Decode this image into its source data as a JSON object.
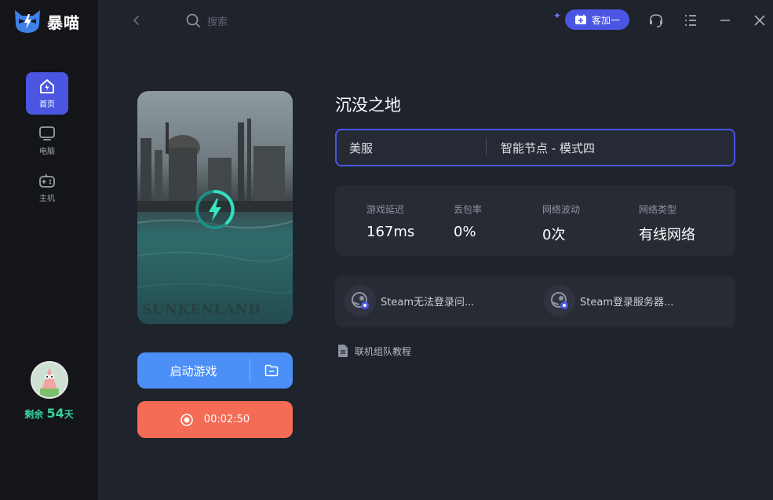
{
  "app": {
    "name": "暴喵"
  },
  "nav": {
    "items": [
      {
        "label": "首页",
        "icon": "home-icon",
        "active": true
      },
      {
        "label": "电脑",
        "icon": "monitor-icon",
        "active": false
      },
      {
        "label": "主机",
        "icon": "gamepad-icon",
        "active": false
      }
    ]
  },
  "user": {
    "remain_prefix": "剩余",
    "remain_days": "54",
    "remain_suffix": "天"
  },
  "topbar": {
    "search_placeholder": "搜索",
    "add_button_label": "客加一",
    "icons": [
      "back-icon",
      "search-icon",
      "headset-icon",
      "menu-icon",
      "minimize-icon",
      "close-icon"
    ]
  },
  "game": {
    "name": "沉没之地",
    "art_title": "SUNKENLAND",
    "start_label": "启动游戏",
    "timer": "00:02:50"
  },
  "server": {
    "region": "美服",
    "node": "智能节点 - 模式四"
  },
  "stats": [
    {
      "label": "游戏延迟",
      "value": "167ms"
    },
    {
      "label": "丢包率",
      "value": "0%"
    },
    {
      "label": "网络波动",
      "value": "0次"
    },
    {
      "label": "网络类型",
      "value": "有线网络"
    }
  ],
  "help": [
    {
      "label": "Steam无法登录问..."
    },
    {
      "label": "Steam登录服务器..."
    }
  ],
  "tutorial": {
    "label": "联机组队教程"
  },
  "colors": {
    "accent": "#4a56e2",
    "start_button": "#4b8ff7",
    "timer_button": "#f46b56",
    "remain_text": "#3ad29f"
  }
}
